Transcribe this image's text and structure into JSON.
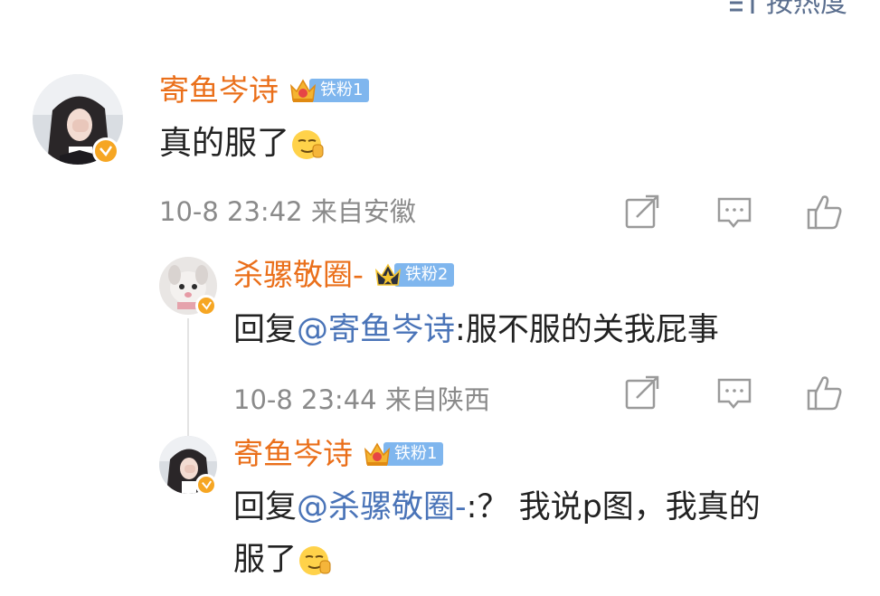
{
  "sort": {
    "label": "按热度",
    "icon": "sort-icon"
  },
  "comments": [
    {
      "user": "寄鱼岑诗",
      "fan_badge": "铁粉1",
      "text": "真的服了",
      "emoji": "smirk-emoji",
      "time": "10-8 23:42",
      "location": "来自安徽"
    },
    {
      "user": "杀骡敬圈-",
      "fan_badge": "铁粉2",
      "reply_prefix": "回复",
      "mention": "@寄鱼岑诗",
      "text": ":服不服的关我屁事",
      "time": "10-8 23:44",
      "location": "来自陕西"
    },
    {
      "user": "寄鱼岑诗",
      "fan_badge": "铁粉1",
      "reply_prefix": "回复",
      "mention": "@杀骡敬圈-",
      "text_line1": ":？ 我说p图，我真的",
      "text_line2": "服了",
      "emoji": "smirk-emoji"
    }
  ],
  "colors": {
    "username": "#ea6f1a",
    "mention": "#4a74b8",
    "meta": "#8a8a8a",
    "fan_badge": "#7fb6ee",
    "verified": "#f6a623"
  },
  "icons": [
    "share-icon",
    "comment-icon",
    "like-icon",
    "crown-icon",
    "verified-icon"
  ]
}
